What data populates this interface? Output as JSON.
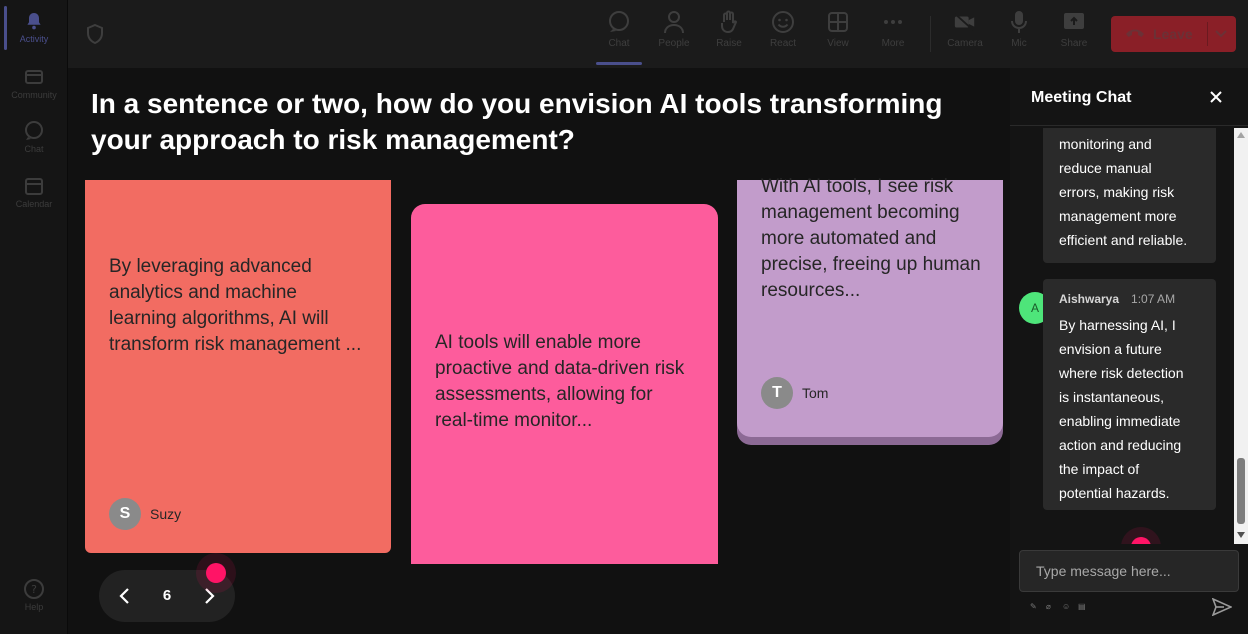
{
  "rail": {
    "items": [
      {
        "label": "Activity",
        "icon": "bell-icon",
        "active": true
      },
      {
        "label": "Community",
        "icon": "community-icon"
      },
      {
        "label": "Chat",
        "icon": "chat-icon"
      },
      {
        "label": "Calendar",
        "icon": "calendar-icon"
      }
    ],
    "help_label": "Help"
  },
  "toolbar": {
    "chat": "Chat",
    "people": "People",
    "raise": "Raise",
    "react": "React",
    "view": "View",
    "more": "More",
    "camera": "Camera",
    "mic": "Mic",
    "share": "Share",
    "leave": "Leave"
  },
  "stage": {
    "question": "In a sentence or two, how do you envision AI tools transforming your approach to risk management?",
    "cards": [
      {
        "text": "By leveraging advanced analytics and machine learning algorithms, AI will transform risk management ...",
        "author": "Suzy",
        "initial": "S",
        "color": "#f26c62"
      },
      {
        "text": "AI tools will enable more proactive and data-driven risk assessments, allowing for real-time monitor...",
        "author": "",
        "initial": "",
        "color": "#fd5c9c"
      },
      {
        "text": "With AI tools, I see risk management becoming more automated and precise, freeing up human resources...",
        "author": "Tom",
        "initial": "T",
        "color": "#c29ccb"
      }
    ],
    "page_number": "6"
  },
  "chat": {
    "title": "Meeting Chat",
    "messages": [
      {
        "author": "",
        "time": "",
        "text_lines": [
          "monitoring and",
          "reduce manual",
          "errors, making risk",
          "management more",
          "efficient and reliable."
        ]
      },
      {
        "author": "Aishwarya",
        "time": "1:07 AM",
        "initial": "A",
        "text_lines": [
          "By harnessing AI, I",
          "envision a future",
          "where risk detection",
          "is instantaneous,",
          "enabling immediate",
          "action and reducing",
          "the impact of",
          "potential hazards."
        ]
      }
    ],
    "input_placeholder": "Type message here..."
  },
  "colors": {
    "accent": "#4a4f8c",
    "leave": "#8a1f27",
    "cursor": "#ff1466",
    "avatar_green": "#4ee57a"
  }
}
